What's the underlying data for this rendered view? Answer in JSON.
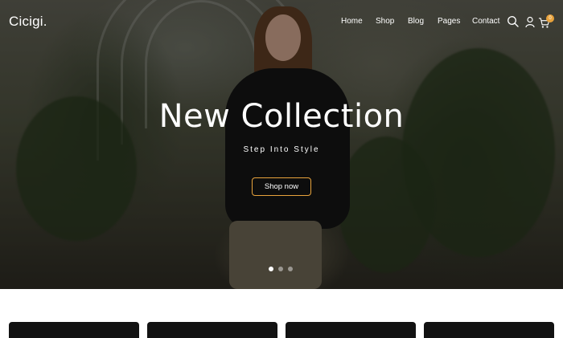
{
  "brand": {
    "logo": "Cicigi."
  },
  "nav": {
    "items": [
      "Home",
      "Shop",
      "Blog",
      "Pages",
      "Contact"
    ],
    "icons": [
      "search-icon",
      "user-icon",
      "cart-icon"
    ],
    "cart_count": "0"
  },
  "hero": {
    "title": "New Collection",
    "subtitle": "Step Into Style",
    "cta_label": "Shop now",
    "slides": 3,
    "active_slide": 1
  },
  "colors": {
    "accent": "#e8a33c",
    "text": "#ffffff",
    "card": "#121212"
  },
  "cards": {
    "count": 4
  }
}
